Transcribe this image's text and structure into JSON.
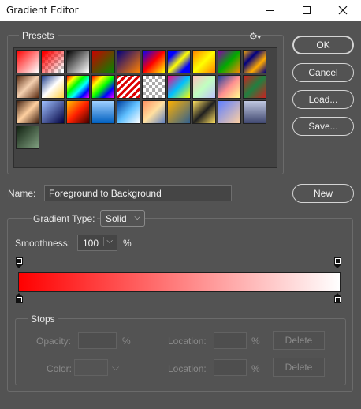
{
  "window": {
    "title": "Gradient Editor"
  },
  "presets": {
    "label": "Presets",
    "gear_icon": "gear-icon",
    "swatches": [
      {
        "bg": "linear-gradient(135deg,#ff0000,#ffffff)"
      },
      {
        "bg": "linear-gradient(135deg,#ff0000 10%,transparent 90%), repeating-conic-gradient(#bbbbbb 0 25%,#ffffff 0 50%) 0 0/8px 8px"
      },
      {
        "bg": "linear-gradient(135deg,#000000,#ffffff)"
      },
      {
        "bg": "linear-gradient(135deg,#cc0000,#008800)"
      },
      {
        "bg": "linear-gradient(135deg,#000080,#ff8000)"
      },
      {
        "bg": "linear-gradient(135deg,#0000ff,#ff0000,#ffff00)"
      },
      {
        "bg": "linear-gradient(135deg,#0000ff 20%,#ffff00 50%,#0000ff 80%)"
      },
      {
        "bg": "linear-gradient(135deg,#ff8000,#ffff00,#ff8000)"
      },
      {
        "bg": "linear-gradient(135deg,#8800aa,#00aa00,#ff8800)"
      },
      {
        "bg": "linear-gradient(135deg,#ffaa00,#000080,#ffaa00,#000080)"
      },
      {
        "bg": "linear-gradient(135deg,#5a2a10,#f4d0b0,#5a2a10)"
      },
      {
        "bg": "linear-gradient(135deg,#1a3a8a,#ffffff,#ffd040)"
      },
      {
        "bg": "linear-gradient(135deg,#ff0000,#ffff00,#00ff00,#00ffff,#0000ff,#ff00ff)"
      },
      {
        "bg": "linear-gradient(135deg,#ff0000,#ffff00,#00ff00,#0000ff,#ff00ff), repeating-conic-gradient(#ccc 0 25%,#fff 0 50%) 0 0/8px 8px"
      },
      {
        "bg": "repeating-linear-gradient(135deg,#dd0000 0 3px,#ffffff 3px 6px)"
      },
      {
        "bg": "repeating-conic-gradient(#aaaaaa 0 25%,#ffffff 0 50%) 0 0/8px 8px"
      },
      {
        "bg": "linear-gradient(135deg,#ff0080,#00c0ff,#ffff00)"
      },
      {
        "bg": "linear-gradient(135deg,#ffc0c0,#c0ffc0,#c0c0ff)"
      },
      {
        "bg": "linear-gradient(135deg,#2040a0,#ff9090,#ffff90)"
      },
      {
        "bg": "linear-gradient(135deg,#cc2020,#208040,#cc2020)"
      },
      {
        "bg": "linear-gradient(135deg,#402010,#ffd0a0,#402010)"
      },
      {
        "bg": "linear-gradient(135deg,#a0c0ff,#000040)"
      },
      {
        "bg": "linear-gradient(135deg,#ffc000,#ff2000,#400000)"
      },
      {
        "bg": "linear-gradient(180deg,#a0d0ff,#0060c0)"
      },
      {
        "bg": "linear-gradient(135deg,#0040a0,#60c0ff,#ffffff)"
      },
      {
        "bg": "linear-gradient(135deg,#ff9060,#ffe0a0,#6080c0)"
      },
      {
        "bg": "linear-gradient(135deg,#ffb000,#306090)"
      },
      {
        "bg": "linear-gradient(135deg,#ffe060,#202020,#ffe060)"
      },
      {
        "bg": "linear-gradient(135deg,#6080ff,#ffd0a0)"
      },
      {
        "bg": "linear-gradient(180deg,#c0c8e0,#404870)"
      },
      {
        "bg": "linear-gradient(135deg,#102010,#80a080)"
      }
    ]
  },
  "buttons": {
    "ok": "OK",
    "cancel": "Cancel",
    "load": "Load...",
    "save": "Save...",
    "new": "New"
  },
  "name": {
    "label": "Name:",
    "value": "Foreground to Background"
  },
  "gradient": {
    "type_label": "Gradient Type:",
    "type_value": "Solid",
    "smoothness_label": "Smoothness:",
    "smoothness_value": "100",
    "smoothness_unit": "%",
    "start_color": "#ff0000",
    "end_color": "#ffffff"
  },
  "stops": {
    "label": "Stops",
    "opacity_label": "Opacity:",
    "opacity_unit": "%",
    "location_label": "Location:",
    "location_unit": "%",
    "color_label": "Color:",
    "delete_label": "Delete"
  }
}
